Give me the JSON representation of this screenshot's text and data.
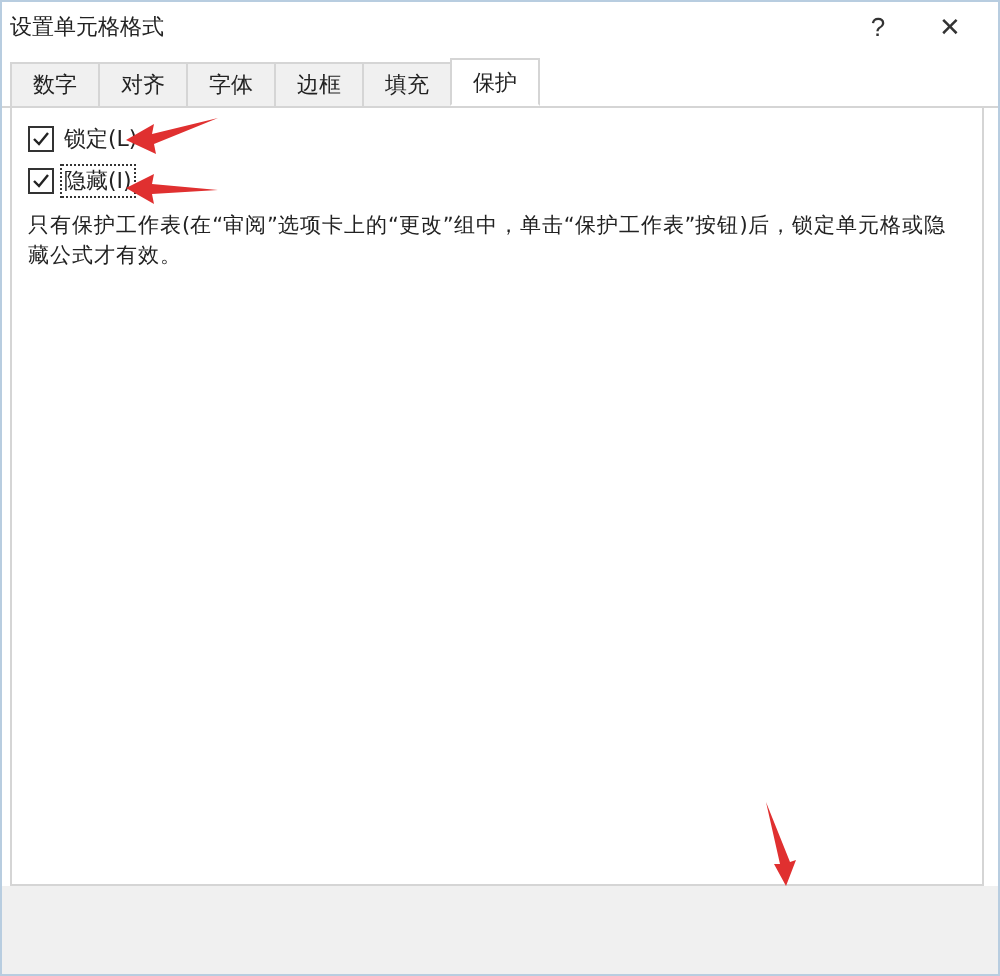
{
  "window": {
    "title": "设置单元格格式",
    "help": "?",
    "close": "✕"
  },
  "tabs": [
    {
      "label": "数字",
      "selected": false
    },
    {
      "label": "对齐",
      "selected": false
    },
    {
      "label": "字体",
      "selected": false
    },
    {
      "label": "边框",
      "selected": false
    },
    {
      "label": "填充",
      "selected": false
    },
    {
      "label": "保护",
      "selected": true
    }
  ],
  "options": [
    {
      "label": "锁定(L)",
      "checked": true,
      "focused": false
    },
    {
      "label": "隐藏(I)",
      "checked": true,
      "focused": true
    }
  ],
  "note": "只有保护工作表(在“审阅”选项卡上的“更改”组中，单击“保护工作表”按钮)后，锁定单元格或隐藏公式才有效。"
}
